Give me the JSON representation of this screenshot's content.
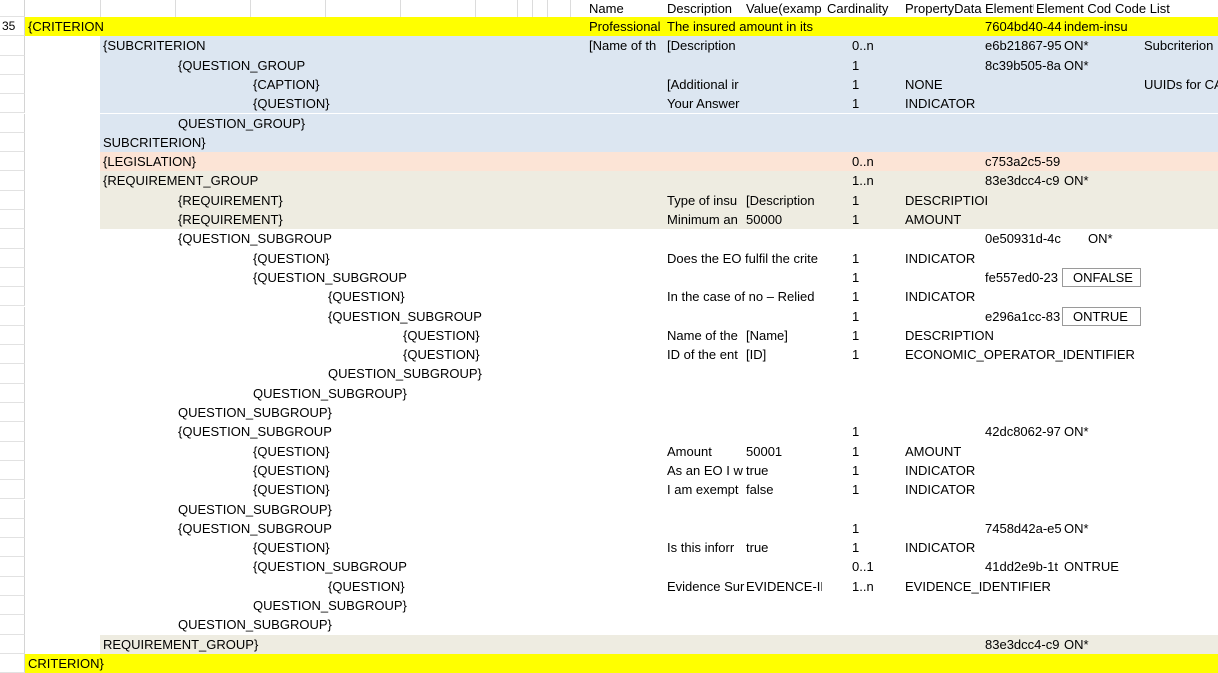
{
  "header": {
    "name": "Name",
    "description": "Description",
    "value": "Value(examp",
    "cardinality": "Cardinality",
    "property": "PropertyData",
    "uuid": "ElementUUID",
    "elemcode": "Element Cod",
    "codelist": "Code List"
  },
  "colors": {
    "yellow": "#ffff00",
    "blue": "#dce6f1",
    "peach": "#fce4d6",
    "tan": "#eeece1"
  },
  "rows": [
    {
      "num": "35",
      "band": "yellow",
      "indent": 0,
      "elem": "{CRITERION",
      "name": "Professional",
      "desc": "The insured amount in its",
      "value": "",
      "card": "",
      "prop": "",
      "uuid": "7604bd40-44",
      "code": "indem-insu",
      "list": ""
    },
    {
      "num": "",
      "band": "blue",
      "indent": 1,
      "elem": "{SUBCRITERION",
      "name": "[Name of th",
      "desc": "[Description",
      "value": "",
      "card": "0..n",
      "prop": "",
      "uuid": "e6b21867-95",
      "code": "ON*",
      "list": "Subcriterion"
    },
    {
      "num": "",
      "band": "blue",
      "indent": 2,
      "elem": "{QUESTION_GROUP",
      "name": "",
      "desc": "",
      "value": "",
      "card": "1",
      "prop": "",
      "uuid": "8c39b505-8a",
      "code": "ON*",
      "list": ""
    },
    {
      "num": "",
      "band": "blue",
      "indent": 3,
      "elem": "{CAPTION}",
      "name": "",
      "desc": "[Additional ir",
      "value": "",
      "card": "1",
      "prop": "NONE",
      "uuid": "",
      "code": "",
      "list": "UUIDs for CA"
    },
    {
      "num": "",
      "band": "blue",
      "indent": 3,
      "elem": "{QUESTION}",
      "name": "",
      "desc": "Your Answer",
      "value": "",
      "card": "1",
      "prop": "INDICATOR",
      "uuid": "",
      "code": "",
      "list": ""
    },
    {
      "num": "",
      "band": "blue",
      "indent": 2,
      "elem": "QUESTION_GROUP}",
      "name": "",
      "desc": "",
      "value": "",
      "card": "",
      "prop": "",
      "uuid": "",
      "code": "",
      "list": ""
    },
    {
      "num": "",
      "band": "blue",
      "indent": 1,
      "elem": "SUBCRITERION}",
      "name": "",
      "desc": "",
      "value": "",
      "card": "",
      "prop": "",
      "uuid": "",
      "code": "",
      "list": ""
    },
    {
      "num": "",
      "band": "peach",
      "indent": 1,
      "elem": "{LEGISLATION}",
      "name": "",
      "desc": "",
      "value": "",
      "card": "0..n",
      "prop": "",
      "uuid": "c753a2c5-59",
      "code": "",
      "list": ""
    },
    {
      "num": "",
      "band": "tan",
      "indent": 1,
      "elem": "{REQUIREMENT_GROUP",
      "name": "",
      "desc": "",
      "value": "",
      "card": "1..n",
      "prop": "",
      "uuid": "83e3dcc4-c9",
      "code": "ON*",
      "list": ""
    },
    {
      "num": "",
      "band": "tan",
      "indent": 2,
      "elem": "{REQUIREMENT}",
      "name": "",
      "desc": "Type of insu",
      "value": "[Description",
      "card": "1",
      "prop": "DESCRIPTIOI",
      "uuid": "",
      "code": "",
      "list": ""
    },
    {
      "num": "",
      "band": "tan",
      "indent": 2,
      "elem": "{REQUIREMENT}",
      "name": "",
      "desc": "Minimum an",
      "value": "50000",
      "card": "1",
      "prop": "AMOUNT",
      "uuid": "",
      "code": "",
      "list": ""
    },
    {
      "num": "",
      "band": "",
      "indent": 2,
      "elem": "{QUESTION_SUBGROUP",
      "name": "",
      "desc": "",
      "value": "",
      "card": "",
      "prop": "",
      "uuid": "0e50931d-4c",
      "code": "ON*",
      "list": "",
      "codepad": true
    },
    {
      "num": "",
      "band": "",
      "indent": 3,
      "elem": "{QUESTION}",
      "name": "",
      "desc": "Does the EO fulfil the crite",
      "value": "",
      "card": "1",
      "prop": "INDICATOR",
      "uuid": "",
      "code": "",
      "list": ""
    },
    {
      "num": "",
      "band": "",
      "indent": 3,
      "elem": "{QUESTION_SUBGROUP",
      "name": "",
      "desc": "",
      "value": "",
      "card": "1",
      "prop": "",
      "uuid": "fe557ed0-23",
      "code": "ONFALSE",
      "list": "",
      "boxed": true
    },
    {
      "num": "",
      "band": "",
      "indent": 4,
      "elem": "{QUESTION}",
      "name": "",
      "desc": "In the case of no – Relied",
      "value": "",
      "card": "1",
      "prop": "INDICATOR",
      "uuid": "",
      "code": "",
      "list": ""
    },
    {
      "num": "",
      "band": "",
      "indent": 4,
      "elem": "{QUESTION_SUBGROUP",
      "name": "",
      "desc": "",
      "value": "",
      "card": "1",
      "prop": "",
      "uuid": "e296a1cc-83",
      "code": "ONTRUE",
      "list": "",
      "boxed": true
    },
    {
      "num": "",
      "band": "",
      "indent": 5,
      "elem": "{QUESTION}",
      "name": "",
      "desc": "Name of the",
      "value": "[Name]",
      "card": "1",
      "prop": "DESCRIPTION",
      "uuid": "",
      "code": "",
      "list": ""
    },
    {
      "num": "",
      "band": "",
      "indent": 5,
      "elem": "{QUESTION}",
      "name": "",
      "desc": "ID of the ent",
      "value": "[ID]",
      "card": "1",
      "prop": "ECONOMIC_OPERATOR_IDENTIFIER",
      "uuid": "",
      "code": "",
      "list": ""
    },
    {
      "num": "",
      "band": "",
      "indent": 4,
      "elem": "QUESTION_SUBGROUP}",
      "name": "",
      "desc": "",
      "value": "",
      "card": "",
      "prop": "",
      "uuid": "",
      "code": "",
      "list": ""
    },
    {
      "num": "",
      "band": "",
      "indent": 3,
      "elem": "QUESTION_SUBGROUP}",
      "name": "",
      "desc": "",
      "value": "",
      "card": "",
      "prop": "",
      "uuid": "",
      "code": "",
      "list": ""
    },
    {
      "num": "",
      "band": "",
      "indent": 2,
      "elem": "QUESTION_SUBGROUP}",
      "name": "",
      "desc": "",
      "value": "",
      "card": "",
      "prop": "",
      "uuid": "",
      "code": "",
      "list": ""
    },
    {
      "num": "",
      "band": "",
      "indent": 2,
      "elem": "{QUESTION_SUBGROUP",
      "name": "",
      "desc": "",
      "value": "",
      "card": "1",
      "prop": "",
      "uuid": "42dc8062-97",
      "code": "ON*",
      "list": ""
    },
    {
      "num": "",
      "band": "",
      "indent": 3,
      "elem": "{QUESTION}",
      "name": "",
      "desc": "Amount",
      "value": "50001",
      "card": "1",
      "prop": "AMOUNT",
      "uuid": "",
      "code": "",
      "list": ""
    },
    {
      "num": "",
      "band": "",
      "indent": 3,
      "elem": "{QUESTION}",
      "name": "",
      "desc": "As an EO I w",
      "value": "true",
      "card": "1",
      "prop": "INDICATOR",
      "uuid": "",
      "code": "",
      "list": ""
    },
    {
      "num": "",
      "band": "",
      "indent": 3,
      "elem": "{QUESTION}",
      "name": "",
      "desc": "I am exempt",
      "value": "false",
      "card": "1",
      "prop": "INDICATOR",
      "uuid": "",
      "code": "",
      "list": ""
    },
    {
      "num": "",
      "band": "",
      "indent": 2,
      "elem": "QUESTION_SUBGROUP}",
      "name": "",
      "desc": "",
      "value": "",
      "card": "",
      "prop": "",
      "uuid": "",
      "code": "",
      "list": ""
    },
    {
      "num": "",
      "band": "",
      "indent": 2,
      "elem": "{QUESTION_SUBGROUP",
      "name": "",
      "desc": "",
      "value": "",
      "card": "1",
      "prop": "",
      "uuid": "7458d42a-e5",
      "code": "ON*",
      "list": ""
    },
    {
      "num": "",
      "band": "",
      "indent": 3,
      "elem": "{QUESTION}",
      "name": "",
      "desc": "Is this inforr",
      "value": "true",
      "card": "1",
      "prop": "INDICATOR",
      "uuid": "",
      "code": "",
      "list": ""
    },
    {
      "num": "",
      "band": "",
      "indent": 3,
      "elem": "{QUESTION_SUBGROUP",
      "name": "",
      "desc": "",
      "value": "",
      "card": "0..1",
      "prop": "",
      "uuid": "41dd2e9b-1t",
      "code": "ONTRUE",
      "list": ""
    },
    {
      "num": "",
      "band": "",
      "indent": 4,
      "elem": "{QUESTION}",
      "name": "",
      "desc": "Evidence Sur",
      "value": "EVIDENCE-ID",
      "card": "1..n",
      "prop": "EVIDENCE_IDENTIFIER",
      "uuid": "",
      "code": "",
      "list": ""
    },
    {
      "num": "",
      "band": "",
      "indent": 3,
      "elem": "QUESTION_SUBGROUP}",
      "name": "",
      "desc": "",
      "value": "",
      "card": "",
      "prop": "",
      "uuid": "",
      "code": "",
      "list": ""
    },
    {
      "num": "",
      "band": "",
      "indent": 2,
      "elem": "QUESTION_SUBGROUP}",
      "name": "",
      "desc": "",
      "value": "",
      "card": "",
      "prop": "",
      "uuid": "",
      "code": "",
      "list": ""
    },
    {
      "num": "",
      "band": "tan",
      "indent": 1,
      "elem": "REQUIREMENT_GROUP}",
      "name": "",
      "desc": "",
      "value": "",
      "card": "",
      "prop": "",
      "uuid": "83e3dcc4-c9",
      "code": "ON*",
      "list": ""
    },
    {
      "num": "",
      "band": "yellow",
      "indent": 0,
      "elem": "CRITERION}",
      "name": "",
      "desc": "",
      "value": "",
      "card": "",
      "prop": "",
      "uuid": "",
      "code": "",
      "list": ""
    }
  ]
}
